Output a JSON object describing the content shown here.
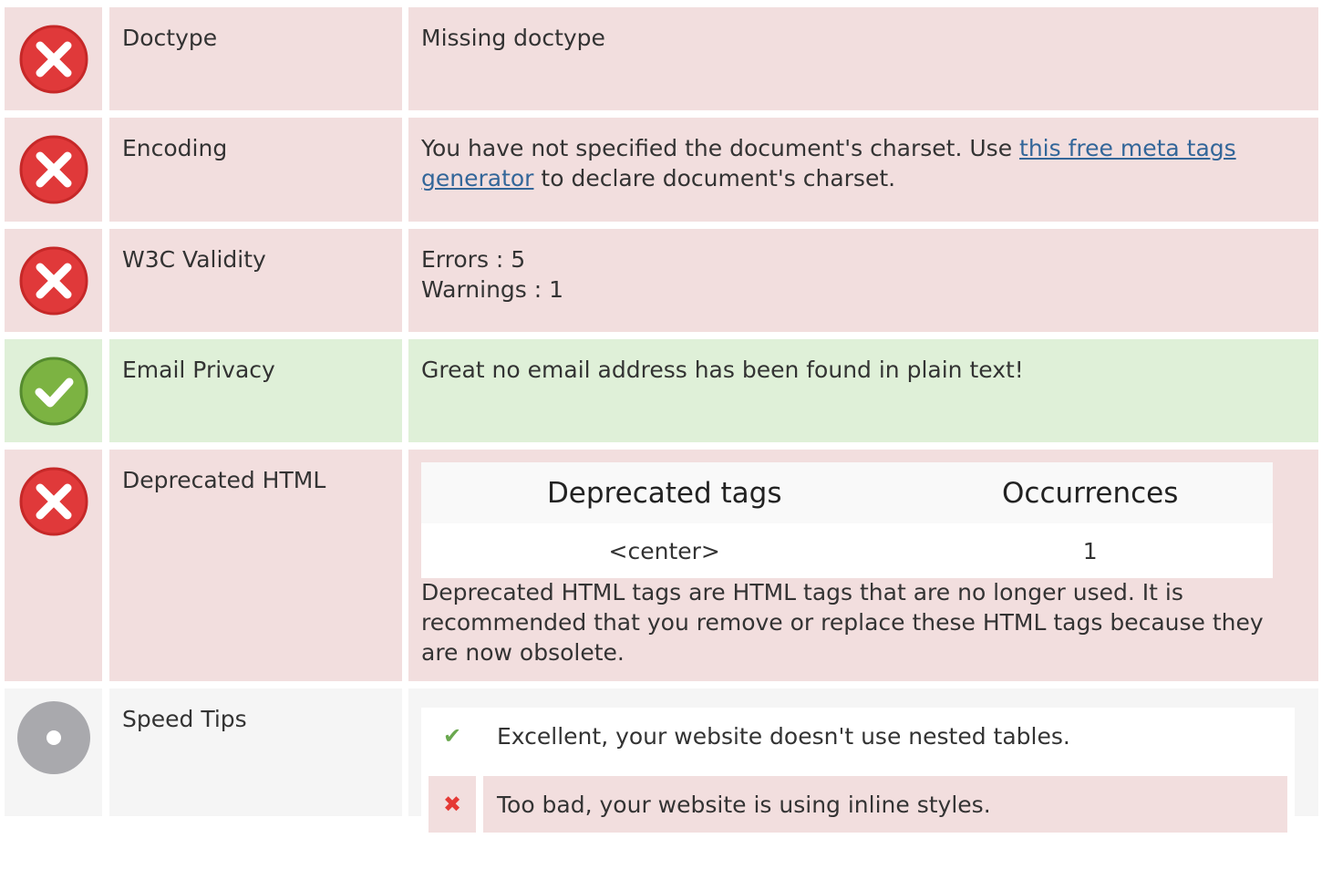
{
  "rows": [
    {
      "status": "error",
      "label": "Doctype",
      "text": "Missing doctype"
    },
    {
      "status": "error",
      "label": "Encoding",
      "text_before": "You have not specified the document's charset. Use ",
      "link_text": "this free meta tags generator",
      "text_after": " to declare document's charset."
    },
    {
      "status": "error",
      "label": "W3C Validity",
      "errors": "Errors : 5",
      "warnings": "Warnings : 1"
    },
    {
      "status": "ok",
      "label": "Email Privacy",
      "text": "Great no email address has been found in plain text!"
    },
    {
      "status": "error",
      "label": "Deprecated HTML",
      "table_headers": [
        "Deprecated tags",
        "Occurrences"
      ],
      "table_rows": [
        [
          "<center>",
          "1"
        ]
      ],
      "note": "Deprecated HTML tags are HTML tags that are no longer used. It is recommended that you remove or replace these HTML tags because they are now obsolete."
    },
    {
      "status": "info",
      "label": "Speed Tips",
      "tips": [
        {
          "kind": "good",
          "text": "Excellent, your website doesn't use nested tables."
        },
        {
          "kind": "bad",
          "text": "Too bad, your website is using inline styles."
        }
      ]
    }
  ],
  "colors": {
    "error_bg": "#f2dede",
    "ok_bg": "#dff0d8",
    "info_bg": "#f5f5f5",
    "error_icon": "#e53935",
    "ok_icon": "#7cb342",
    "info_icon": "#aaaaaa",
    "link": "#336699"
  },
  "icons": {
    "error": "error-x-circle-icon",
    "ok": "check-circle-icon",
    "info": "neutral-dot-circle-icon",
    "tip_good": "checkmark-icon",
    "tip_bad": "cross-icon"
  }
}
